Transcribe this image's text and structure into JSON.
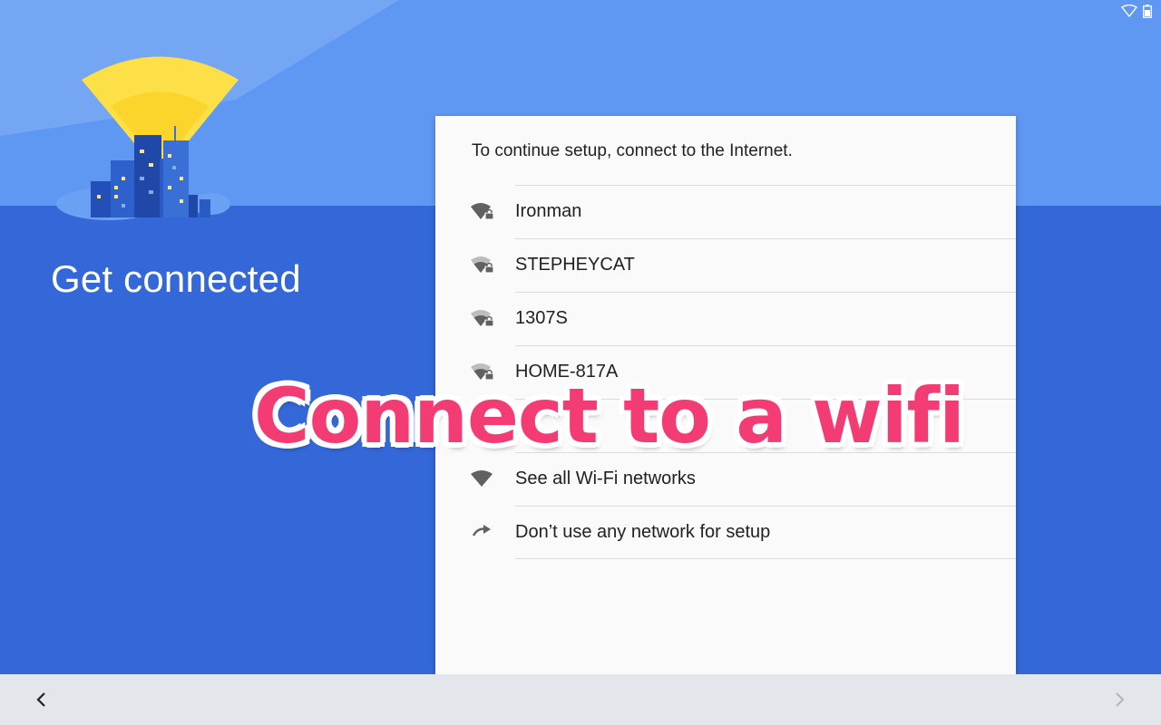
{
  "page": {
    "title": "Get connected",
    "intro": "To continue setup, connect to the Internet."
  },
  "networks": [
    {
      "label": "Ironman",
      "icon": "wifi-lock-icon"
    },
    {
      "label": "STEPHEYCAT",
      "icon": "wifi-lock-icon"
    },
    {
      "label": "1307S",
      "icon": "wifi-lock-icon"
    },
    {
      "label": "HOME-817A",
      "icon": "wifi-lock-icon"
    },
    {
      "label": "",
      "icon": "wifi-lock-icon"
    },
    {
      "label": "See all Wi-Fi networks",
      "icon": "wifi-icon"
    },
    {
      "label": "Don’t use any network for setup",
      "icon": "skip-arrow-icon"
    }
  ],
  "overlay": {
    "caption": "Connect to a wifi"
  },
  "status_bar": {
    "icons": [
      "wifi-outline-icon",
      "battery-icon"
    ]
  },
  "nav_bar": {
    "back_icon": "chevron-left-icon",
    "next_icon": "chevron-right-icon"
  },
  "colors": {
    "background_top": "#5f98f2",
    "background_bottom": "#3468d8",
    "card": "#fafafa",
    "nav_bar": "#e3e6ea",
    "caption": "#f43c74"
  }
}
